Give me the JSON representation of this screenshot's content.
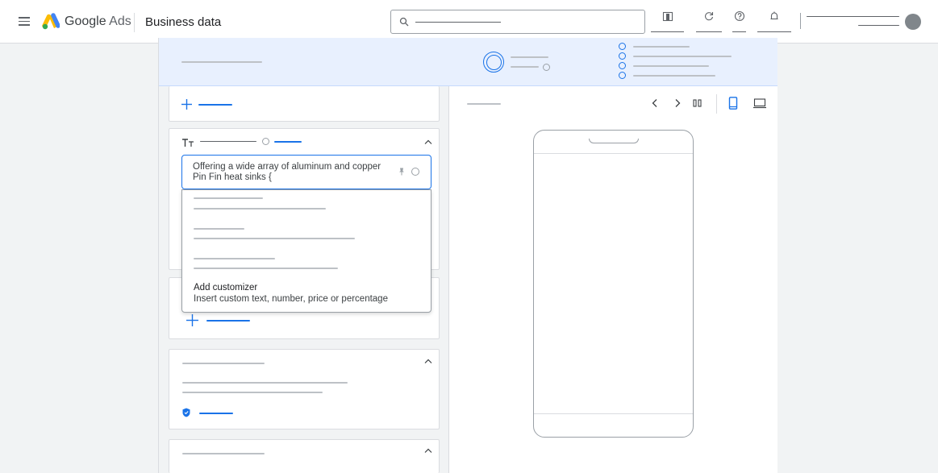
{
  "header": {
    "menu_icon": "menu-icon",
    "logo_icon": "google-ads-logo-icon",
    "app_name_google": "Google",
    "app_name_ads": "Ads",
    "page_title": "Business data",
    "buttons": [
      "reports-icon",
      "refresh-icon",
      "help-icon",
      "notifications-icon"
    ]
  },
  "editor": {
    "headline_value": "Offering a wide array of aluminum and copper Pin Fin heat sinks {",
    "pin_icon": "pin-icon",
    "help_icon": "help-icon",
    "collapse_icon": "chevron-up-icon",
    "text_icon": "text-format-icon"
  },
  "dropdown": {
    "customizer_title": "Add customizer",
    "customizer_subtitle": "Insert custom text, number, price or percentage"
  },
  "preview": {
    "prev_icon": "chevron-left-icon",
    "next_icon": "chevron-right-icon",
    "pause_icon": "pause-icon",
    "mobile_icon": "mobile-icon",
    "desktop_icon": "desktop-icon"
  },
  "colors": {
    "accent": "#1a73e8",
    "banner_bg": "#e8f0fe",
    "placeholder": "#bdc1c6"
  }
}
